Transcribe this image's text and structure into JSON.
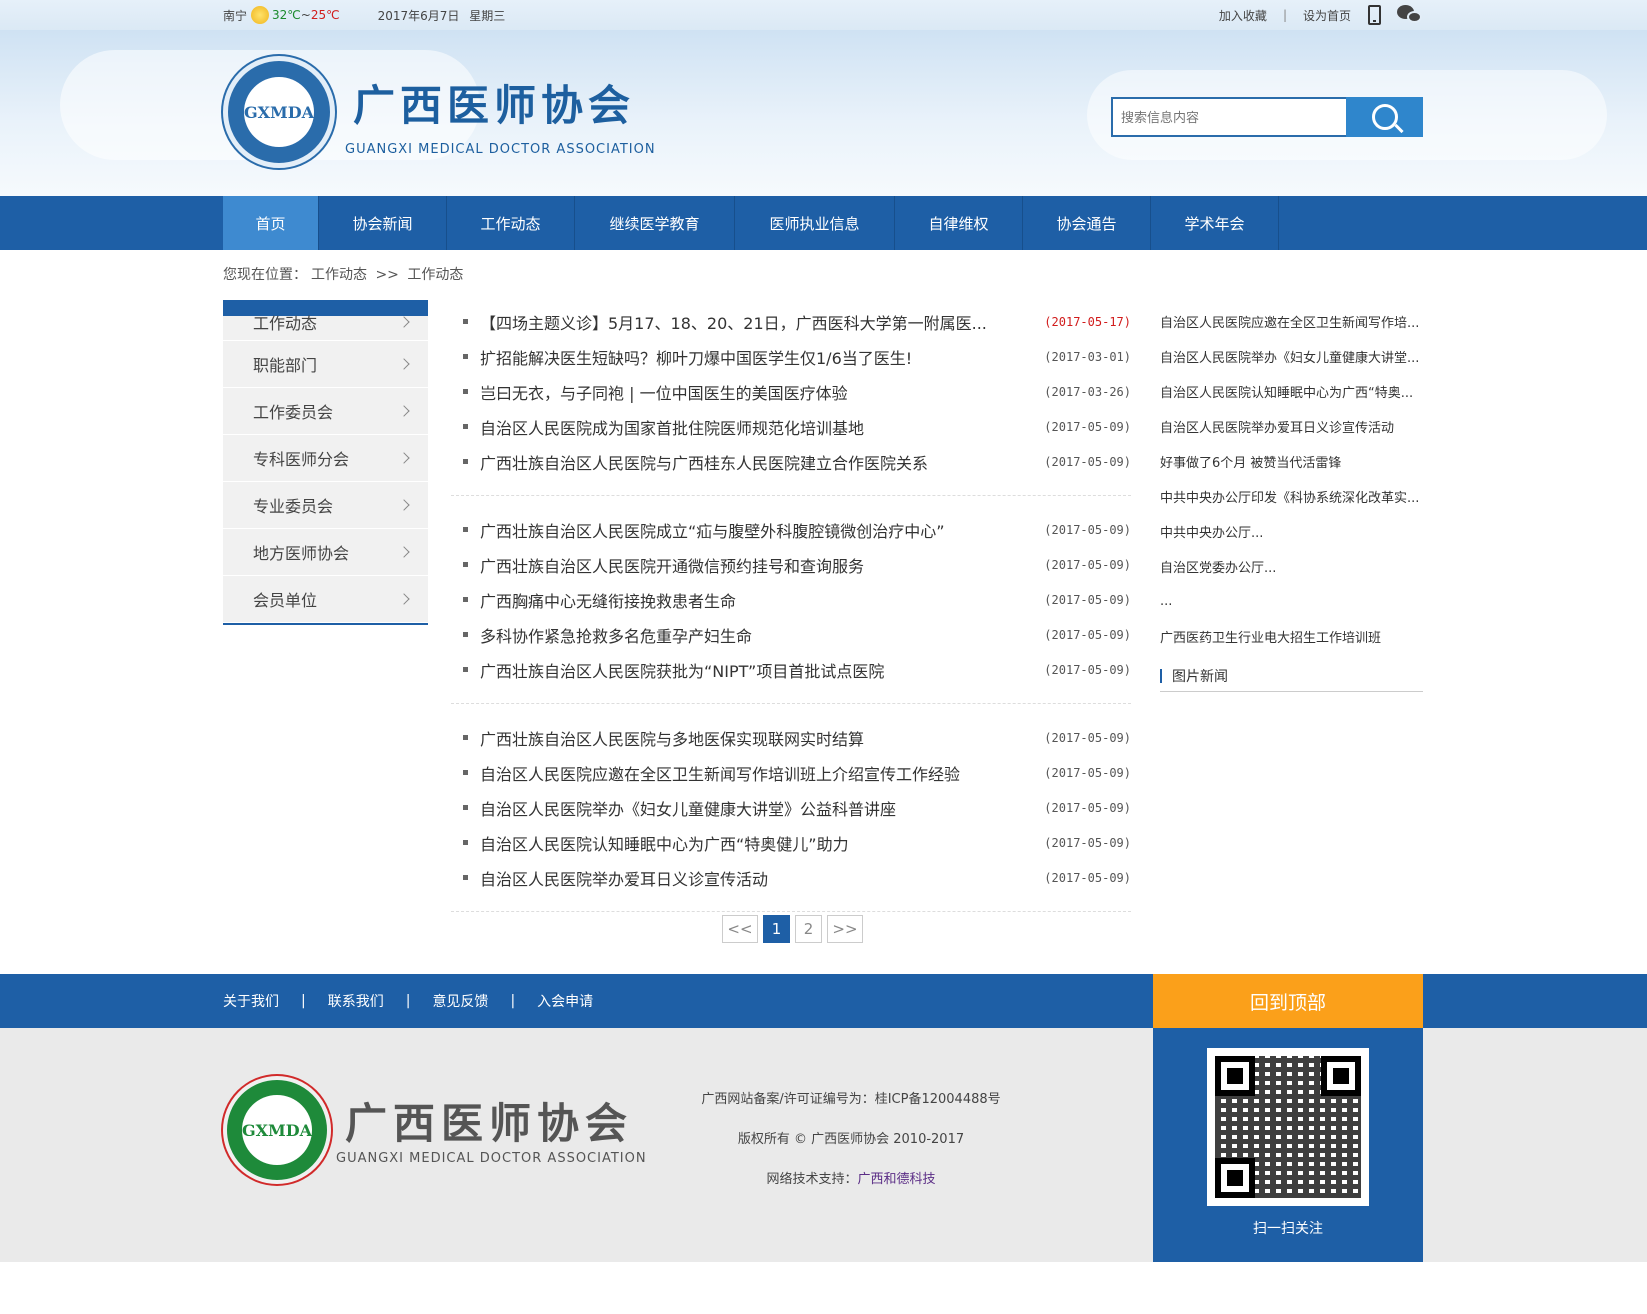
{
  "topbar": {
    "city": "南宁",
    "weather_icon": "sunny-icon",
    "temp_high": "32℃",
    "temp_sep": "~",
    "temp_low": "25℃",
    "date": "2017年6月7日",
    "weekday": "星期三",
    "bookmark": "加入收藏",
    "separator": "|",
    "set_home": "设为首页"
  },
  "header": {
    "logo_abbr": "GXMDA",
    "title": "广西医师协会",
    "subtitle": "GUANGXI MEDICAL DOCTOR ASSOCIATION",
    "search_placeholder": "搜索信息内容"
  },
  "nav": {
    "items": [
      {
        "label": "首页",
        "active": true
      },
      {
        "label": "协会新闻"
      },
      {
        "label": "工作动态"
      },
      {
        "label": "继续医学教育"
      },
      {
        "label": "医师执业信息"
      },
      {
        "label": "自律维权"
      },
      {
        "label": "协会通告"
      },
      {
        "label": "学术年会"
      }
    ]
  },
  "breadcrumb": {
    "prefix": "您现在位置：",
    "level1": "工作动态",
    "sep": ">>",
    "level2": "工作动态"
  },
  "leftmenu": [
    "工作动态",
    "职能部门",
    "工作委员会",
    "专科医师分会",
    "专业委员会",
    "地方医师协会",
    "会员单位"
  ],
  "news_groups": [
    [
      {
        "title": "【四场主题义诊】5月17、18、20、21日，广西医科大学第一附属医...",
        "date": "(2017-05-17)",
        "highlight": true
      },
      {
        "title": "扩招能解决医生短缺吗？柳叶刀爆中国医学生仅1/6当了医生!",
        "date": "(2017-03-01)"
      },
      {
        "title": "岂曰无衣，与子同袍 | 一位中国医生的美国医疗体验",
        "date": "(2017-03-26)"
      },
      {
        "title": "自治区人民医院成为国家首批住院医师规范化培训基地",
        "date": "(2017-05-09)"
      },
      {
        "title": "广西壮族自治区人民医院与广西桂东人民医院建立合作医院关系",
        "date": "(2017-05-09)"
      }
    ],
    [
      {
        "title": "广西壮族自治区人民医院成立“疝与腹壁外科腹腔镜微创治疗中心”",
        "date": "(2017-05-09)"
      },
      {
        "title": "广西壮族自治区人民医院开通微信预约挂号和查询服务",
        "date": "(2017-05-09)"
      },
      {
        "title": "广西胸痛中心无缝衔接挽救患者生命",
        "date": "(2017-05-09)"
      },
      {
        "title": "多科协作紧急抢救多名危重孕产妇生命",
        "date": "(2017-05-09)"
      },
      {
        "title": "广西壮族自治区人民医院获批为“NIPT”项目首批试点医院",
        "date": "(2017-05-09)"
      }
    ],
    [
      {
        "title": "广西壮族自治区人民医院与多地医保实现联网实时结算",
        "date": "(2017-05-09)"
      },
      {
        "title": "自治区人民医院应邀在全区卫生新闻写作培训班上介绍宣传工作经验",
        "date": "(2017-05-09)"
      },
      {
        "title": "自治区人民医院举办《妇女儿童健康大讲堂》公益科普讲座",
        "date": "(2017-05-09)"
      },
      {
        "title": "自治区人民医院认知睡眠中心为广西“特奥健儿”助力",
        "date": "(2017-05-09)"
      },
      {
        "title": "自治区人民医院举办爱耳日义诊宣传活动",
        "date": "(2017-05-09)"
      }
    ]
  ],
  "pager": {
    "prev": "<<",
    "pages": [
      "1",
      "2"
    ],
    "current": "1",
    "next": ">>"
  },
  "side": {
    "items": [
      "自治区人民医院应邀在全区卫生新闻写作培...",
      "自治区人民医院举办《妇女儿童健康大讲堂...",
      "自治区人民医院认知睡眠中心为广西“特奥...",
      "自治区人民医院举办爱耳日义诊宣传活动",
      "好事做了6个月 被赞当代活雷锋",
      "中共中央办公厅印发《科协系统深化改革实...",
      "中共中央办公厅...",
      "自治区党委办公厅...",
      "...",
      "广西医药卫生行业电大招生工作培训班"
    ],
    "pic_news": "图片新闻"
  },
  "footer": {
    "links": [
      "关于我们",
      "联系我们",
      "意见反馈",
      "入会申请"
    ],
    "separator": "|",
    "back_to_top": "回到顶部",
    "title": "广西医师协会",
    "subtitle": "GUANGXI MEDICAL DOCTOR ASSOCIATION",
    "logo_abbr": "GXMDA",
    "icp": "广西网站备案/许可证编号为：桂ICP备12004488号",
    "copyright": "版权所有 © 广西医师协会 2010-2017",
    "support_label": "网络技术支持：",
    "support_link": "广西和德科技",
    "qr_caption": "扫一扫关注"
  },
  "colors": {
    "primary": "#1e5fa6",
    "nav_active": "#3e8ad0",
    "accent_orange": "#fba01a",
    "date_red": "#d11c1c"
  }
}
